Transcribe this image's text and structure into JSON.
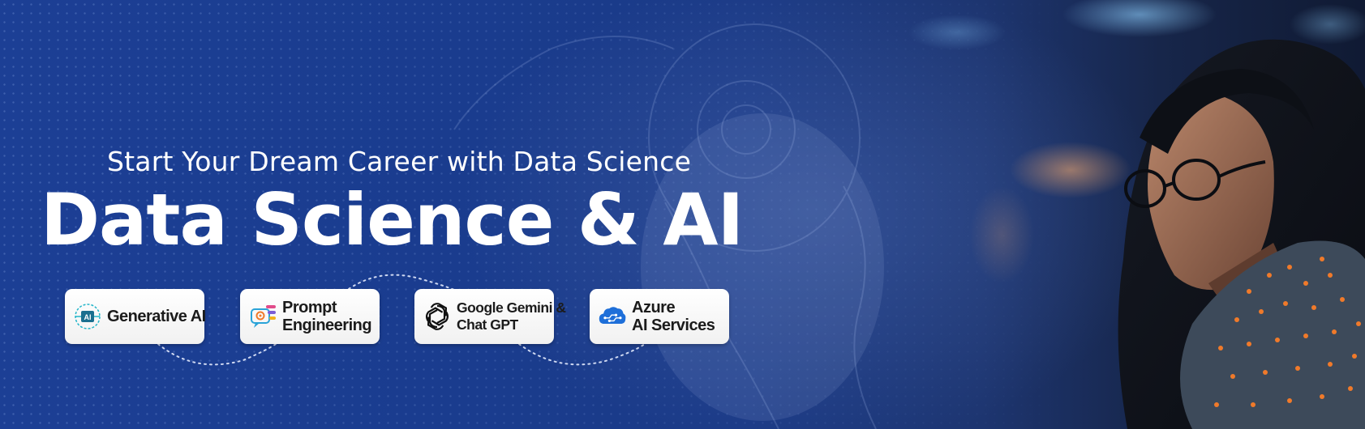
{
  "banner": {
    "subtitle": "Start Your Dream Career with Data Science",
    "title": "Data Science & AI"
  },
  "badges": [
    {
      "icon": "generative-ai-icon",
      "line1": "Generative AI",
      "line2": ""
    },
    {
      "icon": "prompt-engineering-icon",
      "line1": "Prompt",
      "line2": "Engineering"
    },
    {
      "icon": "openai-logo-icon",
      "line1": "Google Gemini &",
      "line2": "Chat GPT"
    },
    {
      "icon": "azure-cloud-brain-icon",
      "line1": "Azure",
      "line2": "AI Services"
    }
  ],
  "colors": {
    "background": "#1b3a86",
    "text": "#ffffff",
    "badge_bg": "#ffffff",
    "badge_text": "#1b1b1b",
    "accent_orange": "#f07a2a",
    "azure_blue": "#1e6fd9"
  }
}
